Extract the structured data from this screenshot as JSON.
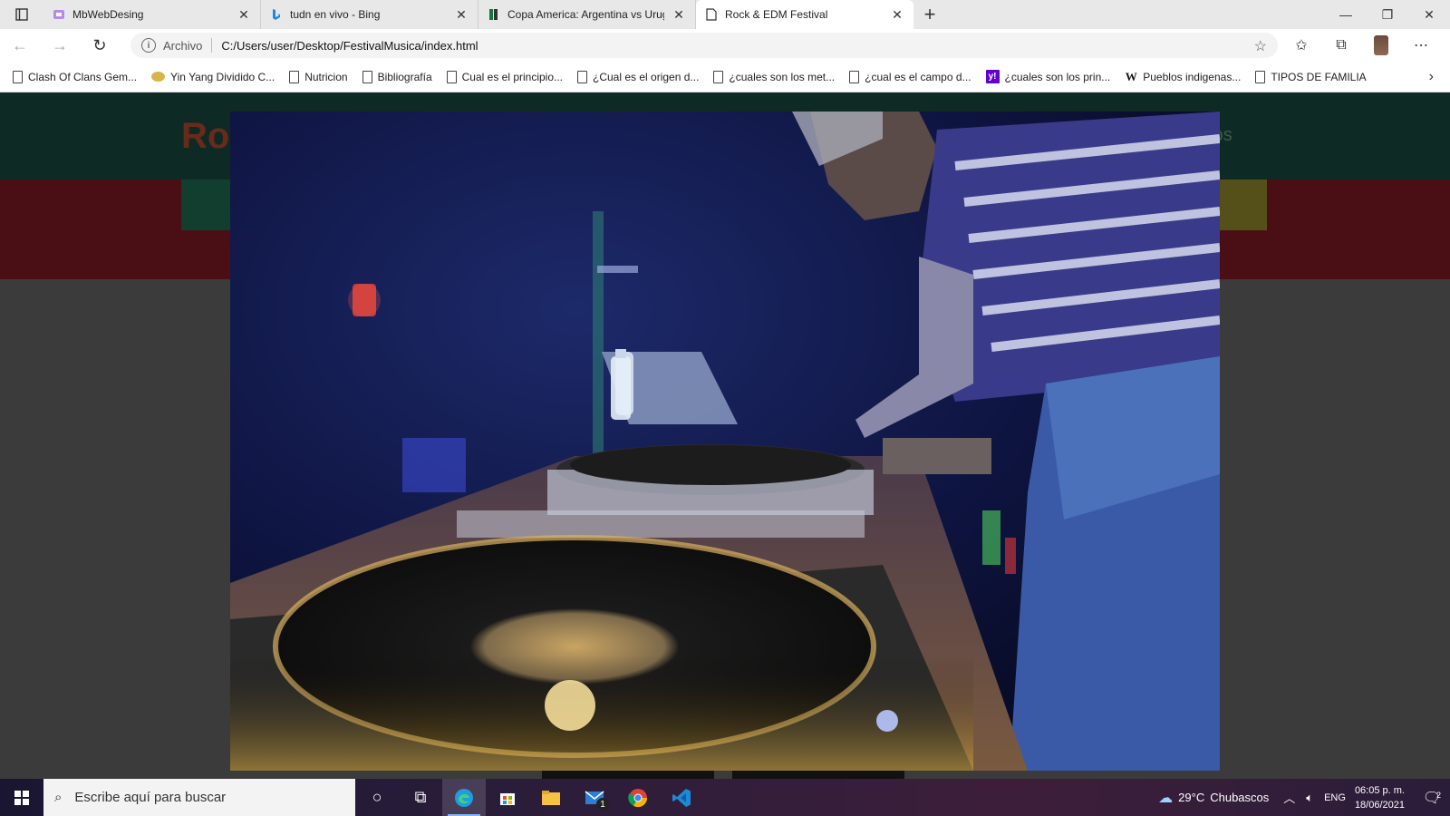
{
  "browser": {
    "tabs": [
      {
        "title": "MbWebDesing",
        "icon": "purple-site-icon"
      },
      {
        "title": "tudn en vivo - Bing",
        "icon": "bing-icon"
      },
      {
        "title": "Copa America: Argentina vs Urug",
        "icon": "green-site-icon"
      },
      {
        "title": "Rock & EDM Festival",
        "icon": "document-icon",
        "active": true
      }
    ],
    "new_tab_symbol": "+",
    "address": {
      "security_label": "Archivo",
      "url": "C:/Users/user/Desktop/FestivalMusica/index.html"
    },
    "bookmarks": [
      {
        "label": "Clash Of Clans Gem...",
        "icon": "document-icon"
      },
      {
        "label": "Yin Yang Dividido C...",
        "icon": "coin-icon"
      },
      {
        "label": "Nutricion",
        "icon": "document-icon"
      },
      {
        "label": "Bibliografía",
        "icon": "document-icon"
      },
      {
        "label": "Cual es el principio...",
        "icon": "document-icon"
      },
      {
        "label": "¿Cual es el origen d...",
        "icon": "document-icon"
      },
      {
        "label": "¿cuales son los met...",
        "icon": "document-icon"
      },
      {
        "label": "¿cual es el campo d...",
        "icon": "document-icon"
      },
      {
        "label": "¿cuales son los prin...",
        "icon": "yahoo-icon"
      },
      {
        "label": "Pueblos indigenas...",
        "icon": "wikipedia-icon"
      },
      {
        "label": "TIPOS DE FAMILIA",
        "icon": "document-icon"
      }
    ]
  },
  "site": {
    "logo_partial": "Ro",
    "nav_partial": "etos"
  },
  "taskbar": {
    "search_placeholder": "Escribe aquí para buscar",
    "mail_badge": "1",
    "weather": {
      "temp": "29°C",
      "condition": "Chubascos"
    },
    "language": "ENG",
    "time": "06:05 p. m.",
    "date": "18/06/2021",
    "notification_count": "2"
  },
  "colors": {
    "site_header": "#0e2a24",
    "site_band": "#4a0e15",
    "overlay_bg": "#3b3b3b",
    "taskbar_accent": "#7fb7ff"
  }
}
